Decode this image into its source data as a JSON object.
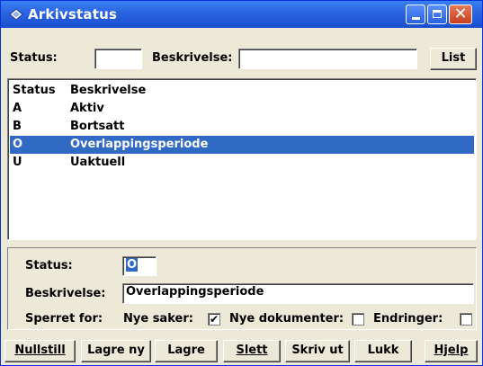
{
  "window": {
    "title": "Arkivstatus"
  },
  "search": {
    "status_label": "Status:",
    "status_value": "",
    "beskrivelse_label": "Beskrivelse:",
    "beskrivelse_value": "",
    "list_button": "List"
  },
  "list": {
    "headers": [
      "Status",
      "Beskrivelse"
    ],
    "rows": [
      {
        "status": "A",
        "beskrivelse": "Aktiv"
      },
      {
        "status": "B",
        "beskrivelse": "Bortsatt"
      },
      {
        "status": "O",
        "beskrivelse": "Overlappingsperiode"
      },
      {
        "status": "U",
        "beskrivelse": "Uaktuell"
      }
    ],
    "selected_index": 2
  },
  "detail": {
    "status_label": "Status:",
    "status_value": "O",
    "beskrivelse_label": "Beskrivelse:",
    "beskrivelse_value": "Overlappingsperiode",
    "sperret_label": "Sperret for:",
    "nye_saker_label": "Nye saker:",
    "nye_saker_checked": true,
    "nye_dokumenter_label": "Nye dokumenter:",
    "nye_dokumenter_checked": false,
    "endringer_label": "Endringer:",
    "endringer_checked": false
  },
  "buttons": {
    "nullstill": "Nullstill",
    "lagre_ny": "Lagre ny",
    "lagre": "Lagre",
    "slett": "Slett",
    "skriv_ut": "Skriv ut",
    "lukk": "Lukk",
    "hjelp": "Hjelp"
  },
  "colors": {
    "selection": "#316ac5",
    "titlebar": "#2a63e0",
    "face": "#ece9d8"
  }
}
